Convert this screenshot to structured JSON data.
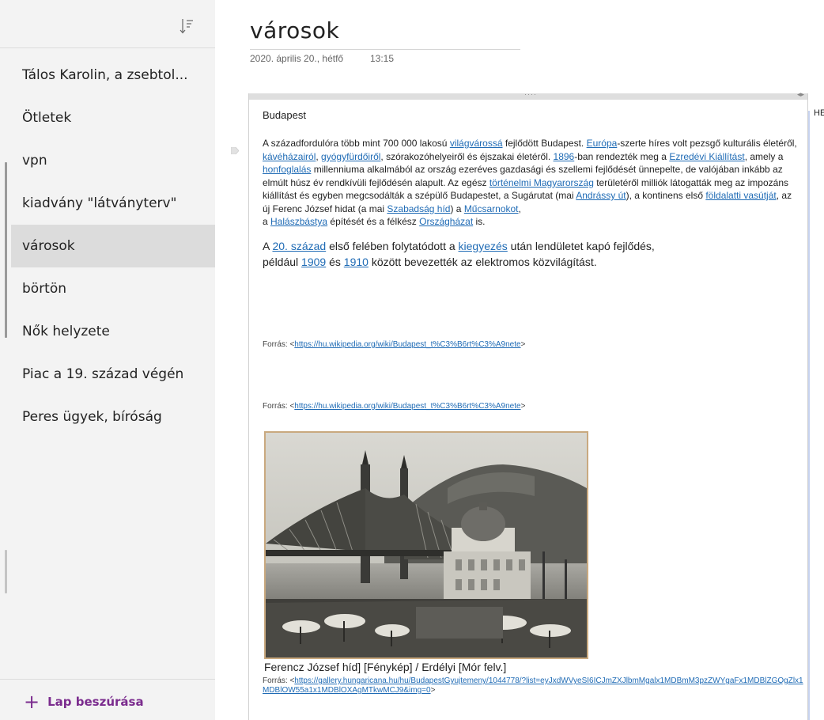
{
  "sidebar": {
    "sort_icon": "sort-descending-icon",
    "pages": [
      {
        "label": "Tálos Karolin, a zsebtol..."
      },
      {
        "label": "Ötletek"
      },
      {
        "label": "vpn"
      },
      {
        "label": "kiadvány \"látványterv\""
      },
      {
        "label": "városok",
        "selected": true
      },
      {
        "label": "börtön"
      },
      {
        "label": "Nők helyzete"
      },
      {
        "label": "Piac a 19. század végén"
      },
      {
        "label": "Peres ügyek, bíróság"
      }
    ],
    "add_page": {
      "icon": "plus-icon",
      "label": "Lap beszúrása"
    }
  },
  "page": {
    "title": "városok",
    "date": "2020. április 20., hétfő",
    "time": "13:15",
    "right_edge_label": "HE"
  },
  "note": {
    "heading": "Budapest",
    "p1": [
      {
        "t": " A századfordulóra több mint 700 000 lakosú "
      },
      {
        "t": "világvárossá",
        "link": true
      },
      {
        "t": " fejlődött Budapest. "
      },
      {
        "t": "Európa",
        "link": true
      },
      {
        "t": "-szerte híres volt pezsgő kulturális életéről, "
      },
      {
        "t": "kávéházairól",
        "link": true
      },
      {
        "t": ", "
      },
      {
        "t": "gyógyfürdőiről",
        "link": true
      },
      {
        "t": ", szórakozóhelyeiről és éjszakai életéről. "
      },
      {
        "t": "1896",
        "link": true
      },
      {
        "t": "-ban rendezték meg a "
      },
      {
        "t": "Ezredévi Kiállítást",
        "link": true
      },
      {
        "t": ", amely a "
      },
      {
        "t": "honfoglalás",
        "link": true
      },
      {
        "t": " millenniuma alkalmából az ország ezeréves gazdasági és szellemi fejlődését ünnepelte, de valójában inkább az elmúlt húsz év rendkívüli fejlődésén alapult. Az egész "
      },
      {
        "t": "történelmi Magyarország",
        "link": true
      },
      {
        "t": " területéről milliók látogatták meg az impozáns kiállítást és egyben megcsodálták a szépülő Budapestet, a Sugárutat (mai "
      },
      {
        "t": "Andrássy út",
        "link": true
      },
      {
        "t": "), a kontinens első "
      },
      {
        "t": "földalatti vasútját",
        "link": true
      },
      {
        "t": ", az új Ferenc József hidat (a mai "
      },
      {
        "t": "Szabadság híd",
        "link": true
      },
      {
        "t": ") a "
      },
      {
        "t": "Műcsarnokot",
        "link": true
      },
      {
        "t": ",",
        "br_after": true
      },
      {
        "t": "a "
      },
      {
        "t": "Halászbástya",
        "link": true
      },
      {
        "t": " építését és a félkész "
      },
      {
        "t": "Országházat",
        "link": true
      },
      {
        "t": " is."
      }
    ],
    "p2": [
      {
        "t": "A "
      },
      {
        "t": "20. század",
        "link": true
      },
      {
        "t": " első felében folytatódott a "
      },
      {
        "t": "kiegyezés",
        "link": true
      },
      {
        "t": " után lendületet kapó fejlődés,",
        "br_after": true
      },
      {
        "t": "például "
      },
      {
        "t": "1909",
        "link": true
      },
      {
        "t": " és "
      },
      {
        "t": "1910",
        "link": true
      },
      {
        "t": " között bevezették az elektromos közvilágítást."
      }
    ],
    "source_prefix": "Forrás: <",
    "source_suffix": ">",
    "source1_url": "https://hu.wikipedia.org/wiki/Budapest_t%C3%B6rt%C3%A9nete",
    "source2_url": "https://hu.wikipedia.org/wiki/Budapest_t%C3%B6rt%C3%A9nete",
    "photo_caption": "Ferencz József híd] [Fénykép] / Erdélyi [Mór felv.]",
    "source3_url": "https://gallery.hungaricana.hu/hu/BudapestGyujtemeny/1044778/?list=eyJxdWVyeSI6ICJmZXJlbmMgalx1MDBmM3pzZWYgaFx1MDBlZGQgZlx1MDBlOW55a1x1MDBlOXAgMTkwMCJ9&img=0"
  }
}
